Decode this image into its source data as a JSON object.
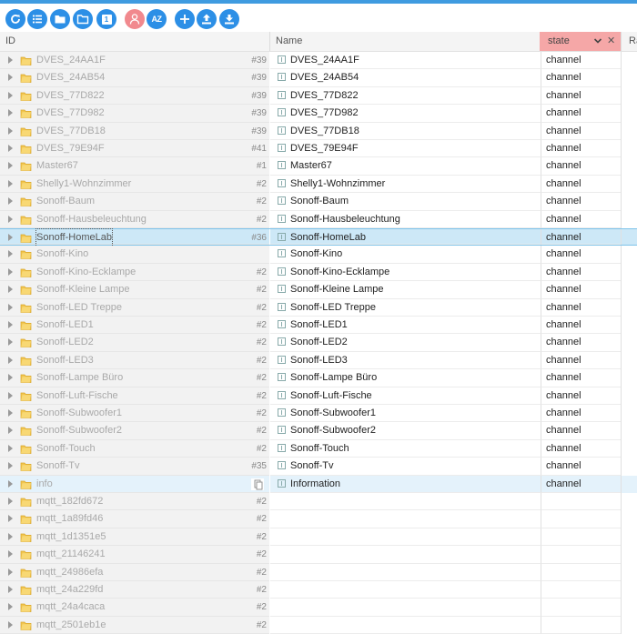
{
  "toolbar": {
    "buttons": [
      {
        "name": "refresh-button",
        "icon": "refresh-icon"
      },
      {
        "name": "list-view-button",
        "icon": "list-icon"
      },
      {
        "name": "folder-button",
        "icon": "folder-icon"
      },
      {
        "name": "folder-open-button",
        "icon": "folder-open-icon"
      },
      {
        "name": "number-toggle-button",
        "icon": "number-icon",
        "label": "1"
      },
      {
        "name": "expert-mode-button",
        "icon": "expert-icon"
      },
      {
        "name": "sort-button",
        "icon": "sort-az-icon",
        "label": "AZ"
      },
      {
        "name": "add-button",
        "icon": "plus-icon"
      },
      {
        "name": "upload-button",
        "icon": "upload-icon"
      },
      {
        "name": "download-button",
        "icon": "download-icon"
      }
    ]
  },
  "header": {
    "id": "ID",
    "name": "Name",
    "state": "state",
    "rest": "Ra"
  },
  "rows": [
    {
      "id": "DVES_24AA1F",
      "count": "#39",
      "name": "DVES_24AA1F",
      "state": "channel"
    },
    {
      "id": "DVES_24AB54",
      "count": "#39",
      "name": "DVES_24AB54",
      "state": "channel"
    },
    {
      "id": "DVES_77D822",
      "count": "#39",
      "name": "DVES_77D822",
      "state": "channel"
    },
    {
      "id": "DVES_77D982",
      "count": "#39",
      "name": "DVES_77D982",
      "state": "channel"
    },
    {
      "id": "DVES_77DB18",
      "count": "#39",
      "name": "DVES_77DB18",
      "state": "channel"
    },
    {
      "id": "DVES_79E94F",
      "count": "#41",
      "name": "DVES_79E94F",
      "state": "channel"
    },
    {
      "id": "Master67",
      "count": "#1",
      "name": "Master67",
      "state": "channel"
    },
    {
      "id": "Shelly1-Wohnzimmer",
      "count": "#2",
      "name": "Shelly1-Wohnzimmer",
      "state": "channel"
    },
    {
      "id": "Sonoff-Baum",
      "count": "#2",
      "name": "Sonoff-Baum",
      "state": "channel"
    },
    {
      "id": "Sonoff-Hausbeleuchtung",
      "count": "#2",
      "name": "Sonoff-Hausbeleuchtung",
      "state": "channel"
    },
    {
      "id": "Sonoff-HomeLab",
      "count": "#36",
      "name": "Sonoff-HomeLab",
      "state": "channel",
      "selected": true
    },
    {
      "id": "Sonoff-Kino",
      "count": "",
      "name": "Sonoff-Kino",
      "state": "channel"
    },
    {
      "id": "Sonoff-Kino-Ecklampe",
      "count": "#2",
      "name": "Sonoff-Kino-Ecklampe",
      "state": "channel"
    },
    {
      "id": "Sonoff-Kleine Lampe",
      "count": "#2",
      "name": "Sonoff-Kleine Lampe",
      "state": "channel"
    },
    {
      "id": "Sonoff-LED Treppe",
      "count": "#2",
      "name": "Sonoff-LED Treppe",
      "state": "channel"
    },
    {
      "id": "Sonoff-LED1",
      "count": "#2",
      "name": "Sonoff-LED1",
      "state": "channel"
    },
    {
      "id": "Sonoff-LED2",
      "count": "#2",
      "name": "Sonoff-LED2",
      "state": "channel"
    },
    {
      "id": "Sonoff-LED3",
      "count": "#2",
      "name": "Sonoff-LED3",
      "state": "channel"
    },
    {
      "id": "Sonoff-Lampe Büro",
      "count": "#2",
      "name": "Sonoff-Lampe Büro",
      "state": "channel"
    },
    {
      "id": "Sonoff-Luft-Fische",
      "count": "#2",
      "name": "Sonoff-Luft-Fische",
      "state": "channel"
    },
    {
      "id": "Sonoff-Subwoofer1",
      "count": "#2",
      "name": "Sonoff-Subwoofer1",
      "state": "channel"
    },
    {
      "id": "Sonoff-Subwoofer2",
      "count": "#2",
      "name": "Sonoff-Subwoofer2",
      "state": "channel"
    },
    {
      "id": "Sonoff-Touch",
      "count": "#2",
      "name": "Sonoff-Touch",
      "state": "channel"
    },
    {
      "id": "Sonoff-Tv",
      "count": "#35",
      "name": "Sonoff-Tv",
      "state": "channel"
    },
    {
      "id": "info",
      "count": "",
      "name": "Information",
      "state": "channel",
      "hover": true
    },
    {
      "id": "mqtt_182fd672",
      "count": "#2",
      "name": "",
      "state": ""
    },
    {
      "id": "mqtt_1a89fd46",
      "count": "#2",
      "name": "",
      "state": ""
    },
    {
      "id": "mqtt_1d1351e5",
      "count": "#2",
      "name": "",
      "state": ""
    },
    {
      "id": "mqtt_21146241",
      "count": "#2",
      "name": "",
      "state": ""
    },
    {
      "id": "mqtt_24986efa",
      "count": "#2",
      "name": "",
      "state": ""
    },
    {
      "id": "mqtt_24a229fd",
      "count": "#2",
      "name": "",
      "state": ""
    },
    {
      "id": "mqtt_24a4caca",
      "count": "#2",
      "name": "",
      "state": ""
    },
    {
      "id": "mqtt_2501eb1e",
      "count": "#2",
      "name": "",
      "state": ""
    }
  ]
}
